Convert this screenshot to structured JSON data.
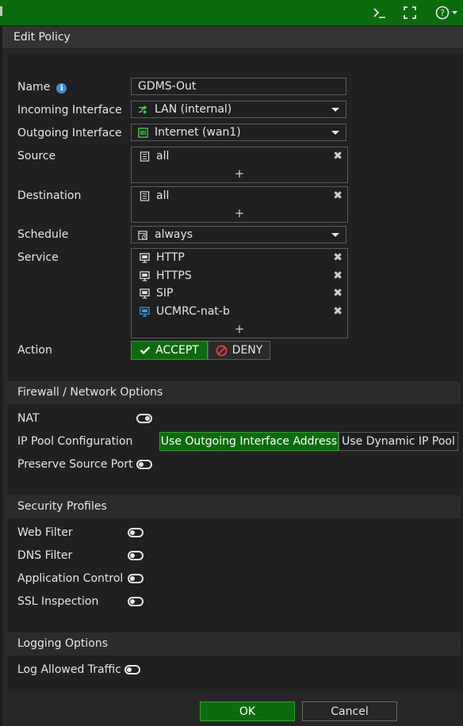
{
  "window": {
    "title": "Edit Policy",
    "icons": {
      "cli": "terminal-icon",
      "fullscreen": "fullscreen-icon",
      "help": "help-icon"
    }
  },
  "form": {
    "name_label": "Name",
    "name_value": "GDMS-Out",
    "incoming_label": "Incoming Interface",
    "incoming_value": "LAN (internal)",
    "outgoing_label": "Outgoing Interface",
    "outgoing_value": "Internet (wan1)",
    "source_label": "Source",
    "source_items": [
      "all"
    ],
    "destination_label": "Destination",
    "destination_items": [
      "all"
    ],
    "schedule_label": "Schedule",
    "schedule_value": "always",
    "service_label": "Service",
    "service_items": [
      "HTTP",
      "HTTPS",
      "SIP",
      "UCMRC-nat-b"
    ],
    "action_label": "Action",
    "accept_label": "ACCEPT",
    "deny_label": "DENY",
    "add_symbol": "+"
  },
  "firewall": {
    "header": "Firewall / Network Options",
    "nat_label": "NAT",
    "nat_enabled": true,
    "ippool_label": "IP Pool Configuration",
    "ippool_option1": "Use Outgoing Interface Address",
    "ippool_option2": "Use Dynamic IP Pool",
    "preserve_label": "Preserve Source Port",
    "preserve_enabled": false
  },
  "security": {
    "header": "Security Profiles",
    "web_filter_label": "Web Filter",
    "dns_filter_label": "DNS Filter",
    "app_control_label": "Application Control",
    "ssl_inspection_label": "SSL Inspection"
  },
  "logging": {
    "header": "Logging Options",
    "log_allowed_label": "Log Allowed Traffic"
  },
  "footer": {
    "ok_label": "OK",
    "cancel_label": "Cancel"
  },
  "colors": {
    "brand_green": "#0c6b0c",
    "accept_green": "#2ea02e",
    "deny_red": "#e03c3c",
    "info_blue": "#3b8fd6"
  }
}
